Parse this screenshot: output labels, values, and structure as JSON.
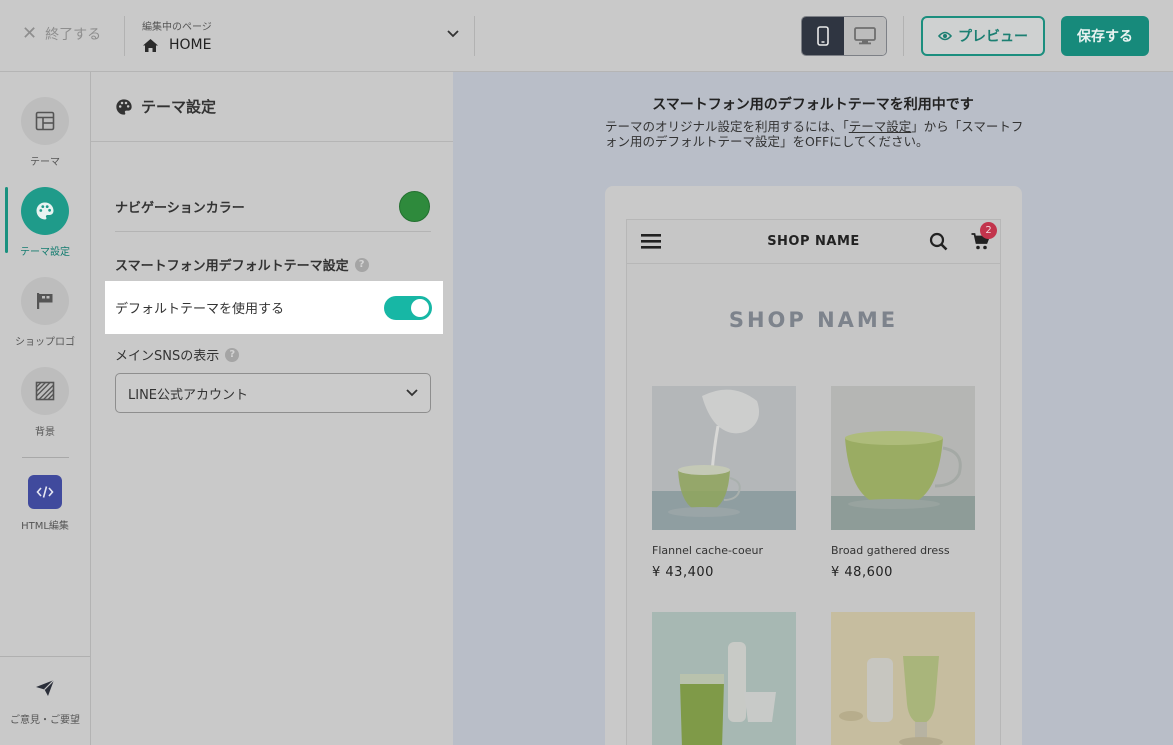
{
  "topbar": {
    "exit_label": "終了する",
    "page_caption": "編集中のページ",
    "page_name": "HOME",
    "preview_label": "プレビュー",
    "save_label": "保存する"
  },
  "rail": {
    "items": [
      {
        "label": "テーマ",
        "icon": "layout-icon"
      },
      {
        "label": "テーマ設定",
        "icon": "palette-icon"
      },
      {
        "label": "ショップロゴ",
        "icon": "flag-icon"
      },
      {
        "label": "背景",
        "icon": "hatch-icon"
      },
      {
        "label": "HTML編集",
        "icon": "code-icon"
      }
    ],
    "feedback_label": "ご意見・ご要望"
  },
  "panel": {
    "title": "テーマ設定",
    "nav_color_label": "ナビゲーションカラー",
    "nav_color": "#2e8a3c",
    "section_title": "スマートフォン用デフォルトテーマ設定",
    "toggle_label": "デフォルトテーマを使用する",
    "toggle_on": true,
    "sns_label": "メインSNSの表示",
    "sns_value": "LINE公式アカウント"
  },
  "preview": {
    "notice_title": "スマートフォン用のデフォルトテーマを利用中です",
    "notice_pre": "テーマのオリジナル設定を利用するには、「",
    "notice_link": "テーマ設定",
    "notice_post": "」から「スマートフォン用のデフォルトテーマ設定」をOFFにしてください。",
    "shop_name_header": "SHOP NAME",
    "cart_count": "2",
    "shop_logo_text": "SHOP NAME",
    "products": [
      {
        "name": "Flannel cache-coeur",
        "price": "¥ 43,400"
      },
      {
        "name": "Broad gathered dress",
        "price": "¥ 48,600"
      },
      {
        "name": "",
        "price": ""
      },
      {
        "name": "",
        "price": ""
      }
    ]
  },
  "colors": {
    "accent": "#178a7b",
    "toggle": "#17b7a5",
    "badge": "#c2344c",
    "html_edit": "#404a9d"
  }
}
